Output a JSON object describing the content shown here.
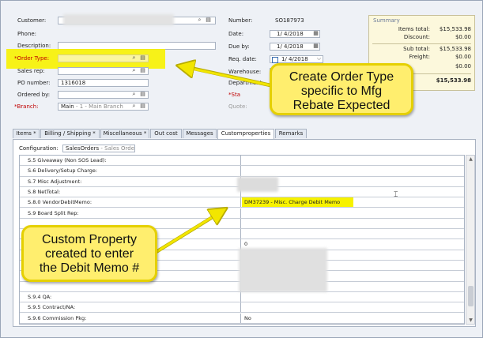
{
  "header": {
    "labels": {
      "customer": "Customer:",
      "phone": "Phone:",
      "description": "Description:",
      "order_type": "*Order Type:",
      "sales_rep": "Sales rep:",
      "po_number": "PO number:",
      "ordered_by": "Ordered by:",
      "branch": "*Branch:",
      "number": "Number:",
      "date": "Date:",
      "due_by": "Due by:",
      "req_date": "Req. date:",
      "warehouse": "Warehouse:",
      "department": "Department:",
      "status": "*Sta",
      "quote": "Quote:"
    },
    "values": {
      "po_number": "1316018",
      "branch_main": "Main",
      "branch_sub": " - 1 - Main Branch",
      "number": "SO187973",
      "date": "1/ 4/2018",
      "due_by": "1/ 4/2018",
      "req_date": "1/ 4/2018"
    }
  },
  "summary": {
    "title": "Summary",
    "rows": [
      {
        "label": "Items total:",
        "value": "$15,533.98"
      },
      {
        "label": "Discount:",
        "value": "$0.00"
      },
      {
        "label": "Sub total:",
        "value": "$15,533.98"
      },
      {
        "label": "Freight:",
        "value": "$0.00"
      },
      {
        "label": "",
        "value": "$0.00"
      }
    ],
    "total": "$15,533.98"
  },
  "tabs": [
    {
      "label": "Items *"
    },
    {
      "label": "Billing / Shipping *"
    },
    {
      "label": "Miscellaneous *"
    },
    {
      "label": "Out cost"
    },
    {
      "label": "Messages"
    },
    {
      "label": "Customproperties"
    },
    {
      "label": "Remarks"
    }
  ],
  "config": {
    "label": "Configuration:",
    "value": "SalesOrders",
    "value_sub": " - Sales Order Bo"
  },
  "grid": {
    "rows": [
      {
        "name": "S.5 Giveaway (Non SOS Lead):",
        "value": ""
      },
      {
        "name": "S.6 Delivery/Setup Charge:",
        "value": ""
      },
      {
        "name": "S.7 Misc Adjustment:",
        "value": ""
      },
      {
        "name": "S.8 NetTotal:",
        "value": ""
      },
      {
        "name": "S.8.0 VendorDebitMemo:",
        "value": "DM37239 - Misc. Charge Debit Memo"
      },
      {
        "name": "S.9 Board Split Rep:",
        "value": ""
      },
      {
        "name": "",
        "value": ""
      },
      {
        "name": "",
        "value": ""
      },
      {
        "name": "",
        "value": "0"
      },
      {
        "name": "",
        "value": ""
      },
      {
        "name": "",
        "value": ""
      },
      {
        "name": "",
        "value": ""
      },
      {
        "name": "",
        "value": ""
      },
      {
        "name": "S.9.4 QA:",
        "value": ""
      },
      {
        "name": "S.9.5 Contract/NA:",
        "value": ""
      },
      {
        "name": "S.9.6 Commission Pkg:",
        "value": "No"
      }
    ]
  },
  "callouts": {
    "order_type": [
      "Create Order Type",
      "specific to Mfg",
      "Rebate Expected"
    ],
    "custom_property": [
      "Custom Property",
      "created to enter",
      "the Debit Memo #"
    ]
  },
  "colors": {
    "highlight": "#f7f200",
    "callout_fill": "#ffee6e",
    "callout_border": "#e5d000",
    "arrow": "#f2e600",
    "required_label": "#c00000"
  }
}
